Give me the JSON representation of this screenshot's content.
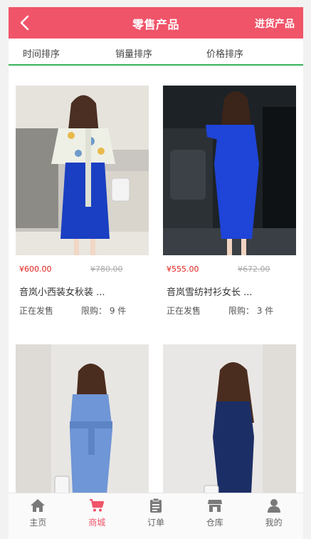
{
  "header": {
    "title": "零售产品",
    "action": "进货产品",
    "back_icon": "chevron-left-icon"
  },
  "sort_tabs": [
    "时间排序",
    "销量排序",
    "价格排序"
  ],
  "accent": "#f05469",
  "underline_color": "#36b35a",
  "products": [
    {
      "price": "¥600.00",
      "original_price": "¥780.00",
      "name": "音岚小西装女秋装 ...",
      "status": "正在发售",
      "limit": "限购：  9 件"
    },
    {
      "price": "¥555.00",
      "original_price": "¥672.00",
      "name": "音岚雪纺衬衫女长 ...",
      "status": "正在发售",
      "limit": "限购：  3 件"
    },
    {
      "price": "",
      "original_price": "",
      "name": "",
      "status": "",
      "limit": ""
    },
    {
      "price": "",
      "original_price": "",
      "name": "",
      "status": "",
      "limit": ""
    }
  ],
  "tabbar": [
    {
      "label": "主页",
      "icon": "home-icon"
    },
    {
      "label": "商城",
      "icon": "cart-icon"
    },
    {
      "label": "订单",
      "icon": "clipboard-icon"
    },
    {
      "label": "仓库",
      "icon": "store-icon"
    },
    {
      "label": "我的",
      "icon": "user-icon"
    }
  ],
  "active_tab": "商城"
}
